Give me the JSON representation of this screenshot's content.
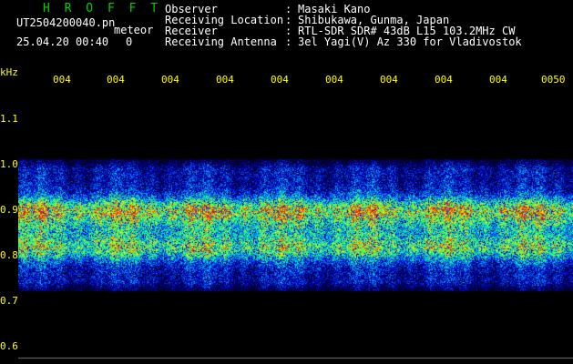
{
  "header": {
    "title": "H R O F F T",
    "filename": "UT2504200040.pn",
    "mode": "meteor",
    "datetime": "25.04.20 00:40",
    "count": "0"
  },
  "info": [
    {
      "label": "Observer",
      "value": "Masaki Kano"
    },
    {
      "label": "Receiving Location",
      "value": "Shibukawa, Gunma, Japan"
    },
    {
      "label": "Receiver",
      "value": "RTL-SDR SDR# 43dB L15 103.2MHz CW"
    },
    {
      "label": "Receiving Antenna",
      "value": "3el Yagi(V) Az 330 for Vladivostok"
    }
  ],
  "separator": ":",
  "axis": {
    "unit": "kHz",
    "y_ticks": [
      "1.1",
      "1.0",
      "0.9",
      "0.8",
      "0.7",
      "0.6"
    ],
    "x_ticks": [
      "004",
      "004",
      "004",
      "004",
      "004",
      "004",
      "004",
      "004",
      "004",
      "0050"
    ]
  },
  "colors": {
    "title": "#00d000",
    "header_text": "#ffffff",
    "tick_text": "#ffff00",
    "baseline": "#ffff00",
    "plot_bg": "#000000"
  },
  "spectrogram": {
    "frequency_range_khz": [
      0.6,
      1.15
    ],
    "bands": [
      {
        "center_khz": 0.94,
        "strength": 1.0
      },
      {
        "center_khz": 0.855,
        "strength": 0.85
      },
      {
        "center_khz": 0.9,
        "strength": 0.45
      }
    ],
    "signal_range_khz": [
      0.76,
      1.05
    ]
  }
}
